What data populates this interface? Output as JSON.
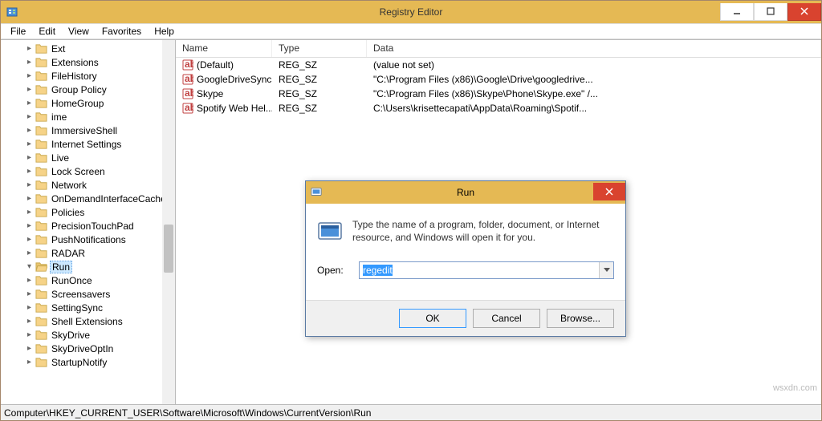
{
  "window": {
    "title": "Registry Editor"
  },
  "menubar": [
    "File",
    "Edit",
    "View",
    "Favorites",
    "Help"
  ],
  "tree": [
    {
      "label": "Ext",
      "selected": false
    },
    {
      "label": "Extensions",
      "selected": false
    },
    {
      "label": "FileHistory",
      "selected": false
    },
    {
      "label": "Group Policy",
      "selected": false
    },
    {
      "label": "HomeGroup",
      "selected": false
    },
    {
      "label": "ime",
      "selected": false
    },
    {
      "label": "ImmersiveShell",
      "selected": false
    },
    {
      "label": "Internet Settings",
      "selected": false
    },
    {
      "label": "Live",
      "selected": false
    },
    {
      "label": "Lock Screen",
      "selected": false
    },
    {
      "label": "Network",
      "selected": false
    },
    {
      "label": "OnDemandInterfaceCache",
      "selected": false
    },
    {
      "label": "Policies",
      "selected": false
    },
    {
      "label": "PrecisionTouchPad",
      "selected": false
    },
    {
      "label": "PushNotifications",
      "selected": false
    },
    {
      "label": "RADAR",
      "selected": false
    },
    {
      "label": "Run",
      "selected": true
    },
    {
      "label": "RunOnce",
      "selected": false
    },
    {
      "label": "Screensavers",
      "selected": false
    },
    {
      "label": "SettingSync",
      "selected": false
    },
    {
      "label": "Shell Extensions",
      "selected": false
    },
    {
      "label": "SkyDrive",
      "selected": false
    },
    {
      "label": "SkyDriveOptIn",
      "selected": false
    },
    {
      "label": "StartupNotify",
      "selected": false
    }
  ],
  "list": {
    "headers": {
      "name": "Name",
      "type": "Type",
      "data": "Data"
    },
    "rows": [
      {
        "name": "(Default)",
        "type": "REG_SZ",
        "data": "(value not set)"
      },
      {
        "name": "GoogleDriveSync",
        "type": "REG_SZ",
        "data": "\"C:\\Program Files (x86)\\Google\\Drive\\googledrive..."
      },
      {
        "name": "Skype",
        "type": "REG_SZ",
        "data": "\"C:\\Program Files (x86)\\Skype\\Phone\\Skype.exe\" /..."
      },
      {
        "name": "Spotify Web Hel...",
        "type": "REG_SZ",
        "data": "C:\\Users\\krisettecapati\\AppData\\Roaming\\Spotif..."
      }
    ]
  },
  "statusbar": "Computer\\HKEY_CURRENT_USER\\Software\\Microsoft\\Windows\\CurrentVersion\\Run",
  "run": {
    "title": "Run",
    "instruction": "Type the name of a program, folder, document, or Internet resource, and Windows will open it for you.",
    "open_label": "Open:",
    "value": "regedit",
    "ok": "OK",
    "cancel": "Cancel",
    "browse": "Browse..."
  },
  "watermark": "wsxdn.com"
}
